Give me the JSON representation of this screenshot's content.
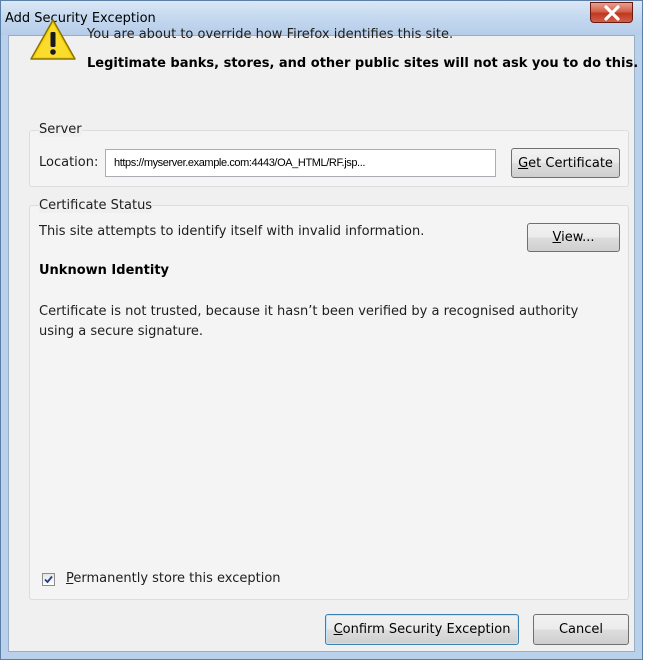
{
  "window": {
    "title": "Add Security Exception"
  },
  "message": {
    "line1": "You are about to override how Firefox identifies this site.",
    "line2": "Legitimate banks, stores, and other public sites will not ask you to do this."
  },
  "server": {
    "group_label": "Server",
    "location_label": "Location:",
    "location_value": "https://myserver.example.com:4443/OA_HTML/RF.jsp...",
    "get_certificate_label": "Get Certificate",
    "get_certificate_mnemonic": "G",
    "get_certificate_rest": "et Certificate"
  },
  "certificate_status": {
    "group_label": "Certificate Status",
    "summary": "This site attempts to identify itself with invalid information.",
    "view_label": "View...",
    "view_mnemonic": "V",
    "view_rest": "iew...",
    "heading": "Unknown Identity",
    "description": "Certificate is not trusted, because it hasn’t been verified by a recognised authority using a secure signature."
  },
  "permanent": {
    "checked": true,
    "label": "Permanently store this exception",
    "mnemonic": "P",
    "rest": "ermanently store this exception"
  },
  "buttons": {
    "confirm_label": "Confirm Security Exception",
    "confirm_mnemonic": "C",
    "confirm_rest": "onfirm Security Exception",
    "cancel_label": "Cancel"
  },
  "icons": {
    "warning": "warning-icon",
    "close": "close-icon",
    "check": "checkmark-icon"
  },
  "colors": {
    "warning_fill": "#f5d000",
    "close_button": "#c84630",
    "accent": "#2a6db8"
  }
}
